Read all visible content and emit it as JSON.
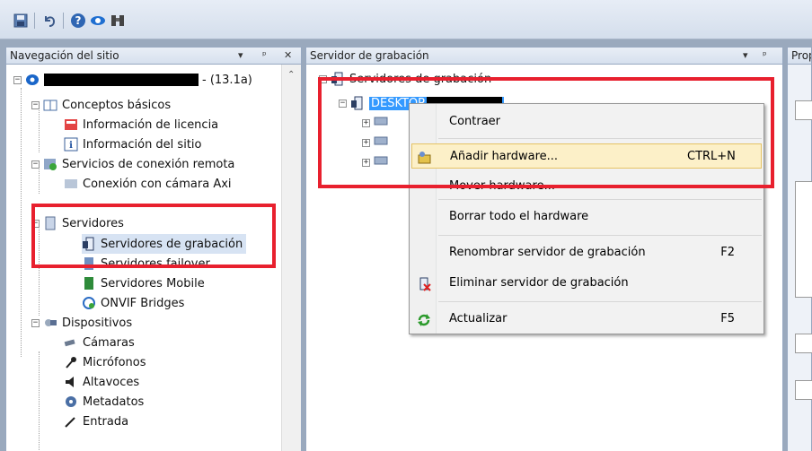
{
  "toolbar": {
    "icons": [
      "save-icon",
      "undo-icon",
      "help-icon",
      "connect-icon",
      "binoculars-icon"
    ]
  },
  "nav_pane": {
    "title": "Navegación del sitio",
    "header_buttons": [
      "▾",
      "ᵖ",
      "✕"
    ],
    "root_suffix": "- (13.1a)",
    "items": {
      "conceptos": "Conceptos básicos",
      "licencia": "Información de licencia",
      "sitio": "Información del sitio",
      "remota": "Servicios de conexión remota",
      "axi": "Conexión con cámara Axi",
      "servidores": "Servidores",
      "grabacion": "Servidores de grabación",
      "failover": "Servidores failover",
      "mobile": "Servidores Mobile",
      "onvif": "ONVIF Bridges",
      "dispositivos": "Dispositivos",
      "camaras": "Cámaras",
      "microfonos": "Micrófonos",
      "altavoces": "Altavoces",
      "metadatos": "Metadatos",
      "entrada": "Entrada"
    }
  },
  "rec_pane": {
    "title": "Servidor de grabación",
    "header_buttons": [
      "▾",
      "ᵖ"
    ],
    "root": "Servidores de grabación",
    "server": "DESKTOP"
  },
  "props_pane": {
    "title": "Prop"
  },
  "context_menu": {
    "items": [
      {
        "label": "Contraer",
        "shortcut": ""
      },
      {
        "label": "Añadir hardware...",
        "shortcut": "CTRL+N"
      },
      {
        "label": "Mover hardware...",
        "shortcut": ""
      },
      {
        "label": "Borrar todo el hardware",
        "shortcut": ""
      },
      {
        "label": "Renombrar servidor de grabación",
        "shortcut": "F2"
      },
      {
        "label": "Eliminar servidor de grabación",
        "shortcut": ""
      },
      {
        "label": "Actualizar",
        "shortcut": "F5"
      }
    ]
  },
  "colors": {
    "highlight_box": "#e8202e",
    "menu_hover": "#fcf0c8",
    "selection": "#3399ff"
  }
}
